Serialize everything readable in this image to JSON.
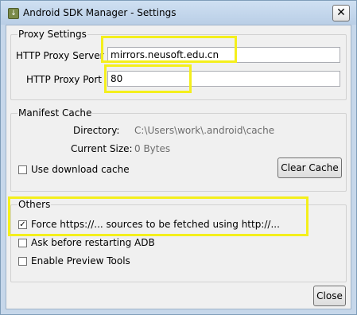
{
  "window": {
    "title": "Android SDK Manager - Settings",
    "close_glyph": "✕"
  },
  "proxy": {
    "group_title": "Proxy Settings",
    "server_label": "HTTP Proxy Server",
    "server_value": "mirrors.neusoft.edu.cn",
    "port_label": "HTTP Proxy Port",
    "port_value": "80"
  },
  "manifest": {
    "group_title": "Manifest Cache",
    "directory_label": "Directory:",
    "directory_value": "C:\\Users\\work\\.android\\cache",
    "size_label": "Current Size:",
    "size_value": "0 Bytes",
    "use_cache_label": "Use download cache",
    "use_cache_checked": false,
    "clear_button": "Clear Cache"
  },
  "others": {
    "group_title": "Others",
    "options": [
      {
        "label": "Force https://... sources to be fetched using http://...",
        "checked": true
      },
      {
        "label": "Ask before restarting ADB",
        "checked": false
      },
      {
        "label": "Enable Preview Tools",
        "checked": false
      }
    ]
  },
  "footer": {
    "close_button": "Close"
  },
  "icons": {
    "app": "android-sdk-manager-icon",
    "check": "✓"
  },
  "colors": {
    "highlight": "#f4ef1c",
    "window_frame": "#c6d7ea",
    "dialog_bg": "#f0f0f0"
  }
}
